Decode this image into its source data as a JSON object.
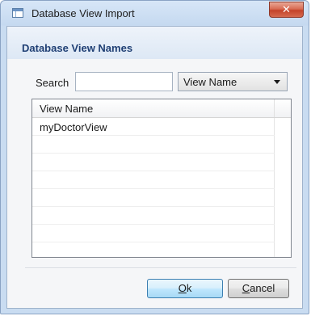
{
  "window": {
    "title": "Database View Import",
    "close_glyph": "✕"
  },
  "section": {
    "title": "Database View Names"
  },
  "search": {
    "label": "Search",
    "value": "",
    "placeholder": ""
  },
  "filter_select": {
    "selected": "View Name"
  },
  "list": {
    "columns": [
      "View Name"
    ],
    "rows": [
      "myDoctorView",
      "",
      "",
      "",
      "",
      "",
      "",
      ""
    ]
  },
  "buttons": {
    "ok": {
      "mnemonic": "O",
      "rest": "k"
    },
    "cancel": {
      "mnemonic": "C",
      "rest": "ancel"
    }
  },
  "icons": {
    "app": "database-view-icon",
    "close": "close-icon",
    "dropdown": "chevron-down-icon"
  },
  "colors": {
    "section_title": "#1f3f74",
    "close_button": "#c4432a",
    "default_button_border": "#3c7fb1"
  }
}
